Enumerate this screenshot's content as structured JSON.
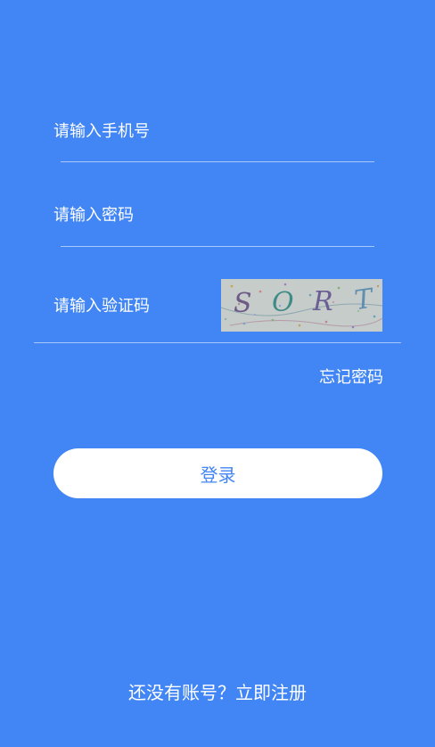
{
  "form": {
    "phone_placeholder": "请输入手机号",
    "password_placeholder": "请输入密码",
    "captcha_placeholder": "请输入验证码",
    "captcha_image": {
      "chars": [
        "S",
        "O",
        "R",
        "T"
      ],
      "char_colors": [
        "#6e5a86",
        "#3f8b86",
        "#6b5f95",
        "#5f8fb0"
      ]
    },
    "forgot_label": "忘记密码",
    "login_label": "登录"
  },
  "footer": {
    "register_label": "还没有账号？立即注册"
  },
  "colors": {
    "background": "#4285f4",
    "button_bg": "#ffffff",
    "button_text": "#4285f4"
  }
}
